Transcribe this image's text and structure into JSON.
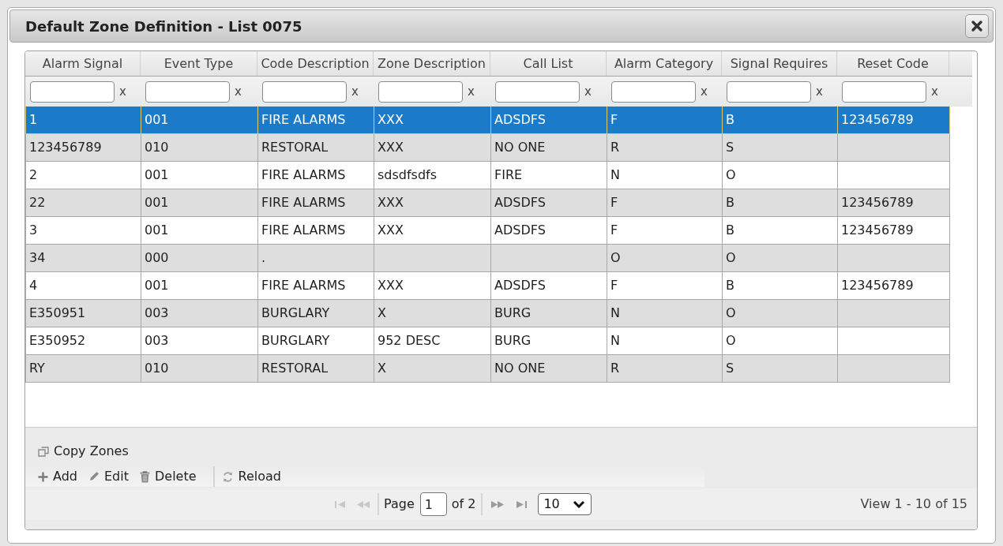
{
  "dialog": {
    "title": "Default Zone Definition - List 0075"
  },
  "table": {
    "columns": [
      {
        "label": "Alarm Signal",
        "filter_clear": "x"
      },
      {
        "label": "Event Type",
        "filter_clear": "x"
      },
      {
        "label": "Code Description",
        "filter_clear": "x"
      },
      {
        "label": "Zone Description",
        "filter_clear": "x"
      },
      {
        "label": "Call List",
        "filter_clear": "x"
      },
      {
        "label": "Alarm Category",
        "filter_clear": "x"
      },
      {
        "label": "Signal Requires",
        "filter_clear": "x"
      },
      {
        "label": "Reset Code",
        "filter_clear": "x"
      }
    ],
    "rows": [
      {
        "selected": true,
        "alarm_signal": "1",
        "event_type": "001",
        "code_description": "FIRE ALARMS",
        "zone_description": "XXX",
        "call_list": "ADSDFS",
        "alarm_category": "F",
        "signal_requires": "B",
        "reset_code": "123456789"
      },
      {
        "selected": false,
        "alarm_signal": "123456789",
        "event_type": "010",
        "code_description": "RESTORAL",
        "zone_description": "XXX",
        "call_list": "NO ONE",
        "alarm_category": "R",
        "signal_requires": "S"
      },
      {
        "selected": false,
        "alarm_signal": "2",
        "event_type": "001",
        "code_description": "FIRE ALARMS",
        "zone_description": "sdsdfsdfs",
        "call_list": "FIRE",
        "alarm_category": "N",
        "signal_requires": "O"
      },
      {
        "selected": false,
        "alarm_signal": "22",
        "event_type": "001",
        "code_description": "FIRE ALARMS",
        "zone_description": "XXX",
        "call_list": "ADSDFS",
        "alarm_category": "F",
        "signal_requires": "B",
        "reset_code": "123456789"
      },
      {
        "selected": false,
        "alarm_signal": "3",
        "event_type": "001",
        "code_description": "FIRE ALARMS",
        "zone_description": "XXX",
        "call_list": "ADSDFS",
        "alarm_category": "F",
        "signal_requires": "B",
        "reset_code": "123456789"
      },
      {
        "selected": false,
        "alarm_signal": "34",
        "event_type": "000",
        "code_description": ".",
        "alarm_category": "O",
        "signal_requires": "O"
      },
      {
        "selected": false,
        "alarm_signal": "4",
        "event_type": "001",
        "code_description": "FIRE ALARMS",
        "zone_description": "XXX",
        "call_list": "ADSDFS",
        "alarm_category": "F",
        "signal_requires": "B",
        "reset_code": "123456789"
      },
      {
        "selected": false,
        "alarm_signal": "E350951",
        "event_type": "003",
        "code_description": "BURGLARY",
        "zone_description": "X",
        "call_list": "BURG",
        "alarm_category": "N",
        "signal_requires": "O"
      },
      {
        "selected": false,
        "alarm_signal": "E350952",
        "event_type": "003",
        "code_description": "BURGLARY",
        "zone_description": "952 DESC",
        "call_list": "BURG",
        "alarm_category": "N",
        "signal_requires": "O"
      },
      {
        "selected": false,
        "alarm_signal": "RY",
        "event_type": "010",
        "code_description": "RESTORAL",
        "zone_description": "X",
        "call_list": "NO ONE",
        "alarm_category": "R",
        "signal_requires": "S"
      }
    ]
  },
  "toolbar": {
    "rows": [
      [
        {
          "kind": "copy",
          "label": "Copy Zones"
        }
      ],
      [
        {
          "kind": "add",
          "label": "Add"
        },
        {
          "kind": "edit",
          "label": "Edit"
        },
        {
          "kind": "delete",
          "label": "Delete"
        },
        {
          "kind": "separator"
        },
        {
          "kind": "reload",
          "label": "Reload"
        }
      ]
    ]
  },
  "pager": {
    "nav": [
      {
        "kind": "first",
        "disabled": true
      },
      {
        "kind": "prev",
        "disabled": true
      },
      {
        "kind": "next",
        "disabled": false
      },
      {
        "kind": "last",
        "disabled": false
      }
    ],
    "page_label": "Page",
    "page_value": "1",
    "page_total": "of 2",
    "page_size": "10",
    "view_text": "View 1 - 10 of 15"
  }
}
